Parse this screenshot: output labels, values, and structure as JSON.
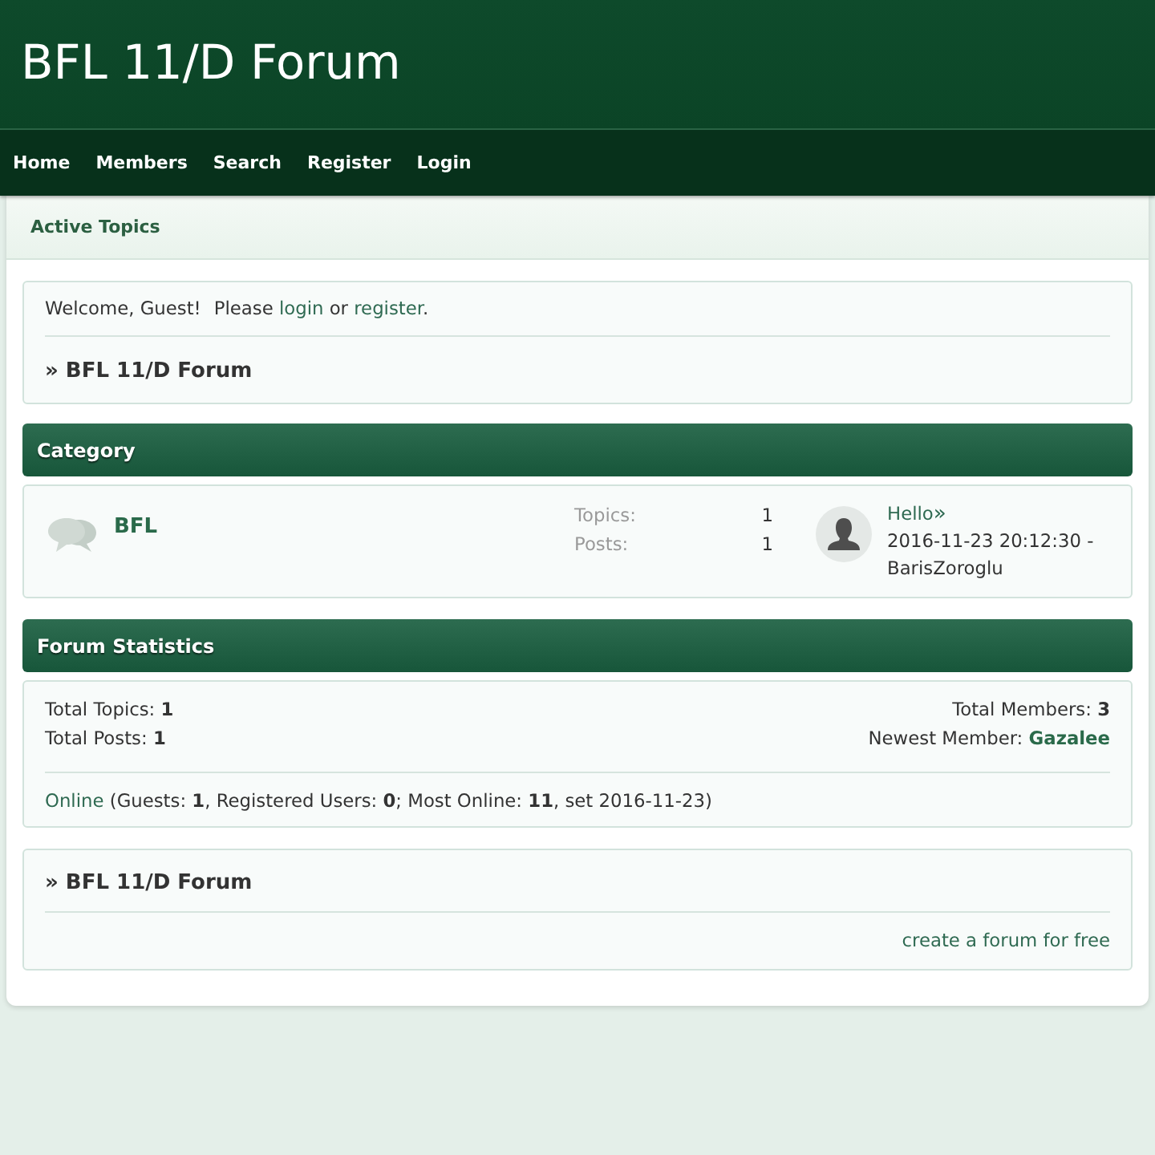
{
  "header": {
    "title": "BFL 11/D Forum"
  },
  "nav": [
    {
      "label": "Home"
    },
    {
      "label": "Members"
    },
    {
      "label": "Search"
    },
    {
      "label": "Register"
    },
    {
      "label": "Login"
    }
  ],
  "subnav": [
    {
      "label": "Active Topics"
    }
  ],
  "welcome": {
    "greeting": "Welcome, Guest!",
    "prompt": [
      {
        "kind": "text",
        "text": "Please "
      },
      {
        "kind": "link",
        "text": "login"
      },
      {
        "kind": "text",
        "text": " or "
      },
      {
        "kind": "link",
        "text": "register"
      },
      {
        "kind": "text",
        "text": "."
      }
    ],
    "breadcrumb": "» BFL 11/D Forum"
  },
  "category": {
    "title": "Category",
    "forums": [
      {
        "name": "BFL",
        "stats": [
          {
            "label": "Topics:",
            "value": "1"
          },
          {
            "label": "Posts:",
            "value": "1"
          }
        ],
        "last_post": {
          "title": "Hello",
          "jump": "»",
          "date": "2016-11-23 20:12:30 -",
          "author": "BarisZoroglu"
        }
      }
    ]
  },
  "statistics": {
    "title": "Forum Statistics",
    "left": [
      {
        "kind": "count",
        "label": "Total Topics:",
        "value": "1"
      },
      {
        "kind": "count",
        "label": "Total Posts:",
        "value": "1"
      }
    ],
    "right": [
      {
        "kind": "count",
        "label": "Total Members:",
        "value": "3"
      },
      {
        "kind": "member",
        "label": "Newest Member:",
        "value": "Gazalee"
      }
    ],
    "online": [
      {
        "kind": "link",
        "text": "Online"
      },
      {
        "kind": "text",
        "text": " (Guests: **1**, Registered Users: **0**; Most Online: **11**, set 2016-11-23)"
      }
    ]
  },
  "footer": {
    "breadcrumb": "» BFL 11/D Forum",
    "link": "create a forum for free"
  }
}
